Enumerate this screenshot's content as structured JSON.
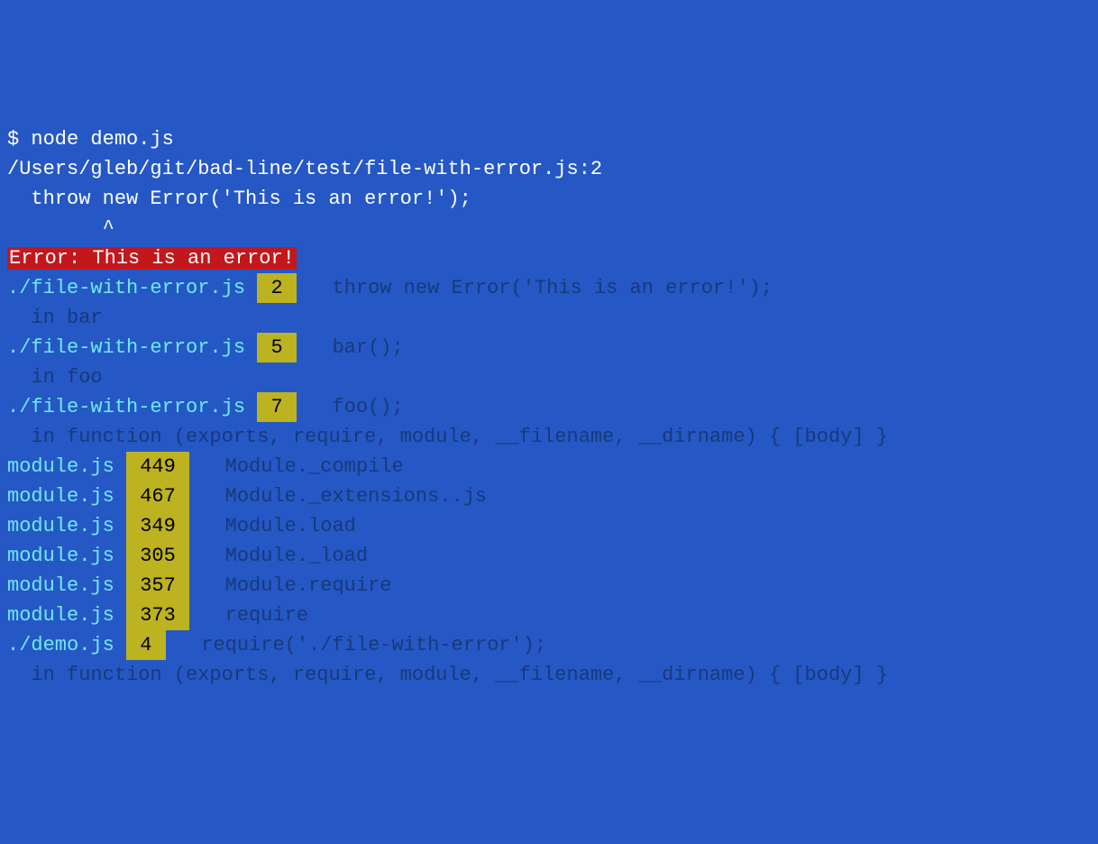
{
  "prompt": {
    "symbol": "$ ",
    "command": "node demo.js"
  },
  "blank1": "",
  "header": {
    "path_line": "/Users/gleb/git/bad-line/test/file-with-error.js:2",
    "code_line": "  throw new Error('This is an error!');",
    "caret_line": "        ^"
  },
  "error_banner": "Error: This is an error!",
  "blank2": "",
  "stack": [
    {
      "kind": "src",
      "file": "./file-with-error.js",
      "line": "2",
      "code": "  throw new Error('This is an error!');"
    },
    {
      "kind": "ctx",
      "text": "  in bar"
    },
    {
      "kind": "src",
      "file": "./file-with-error.js",
      "line": "5",
      "code": "  bar();"
    },
    {
      "kind": "ctx",
      "text": "  in foo"
    },
    {
      "kind": "src",
      "file": "./file-with-error.js",
      "line": "7",
      "code": "  foo();"
    },
    {
      "kind": "ctx",
      "text": "  in function (exports, require, module, __filename, __dirname) { [body] }"
    },
    {
      "kind": "mod",
      "file": "module.js",
      "line": "449",
      "code": "  Module._compile"
    },
    {
      "kind": "mod",
      "file": "module.js",
      "line": "467",
      "code": "  Module._extensions..js"
    },
    {
      "kind": "mod",
      "file": "module.js",
      "line": "349",
      "code": "  Module.load"
    },
    {
      "kind": "mod",
      "file": "module.js",
      "line": "305",
      "code": "  Module._load"
    },
    {
      "kind": "mod",
      "file": "module.js",
      "line": "357",
      "code": "  Module.require"
    },
    {
      "kind": "mod",
      "file": "module.js",
      "line": "373",
      "code": "  require"
    },
    {
      "kind": "src",
      "file": "./demo.js",
      "line": "4",
      "code": "  require('./file-with-error');"
    },
    {
      "kind": "ctx",
      "text": "  in function (exports, require, module, __filename, __dirname) { [body] }"
    }
  ]
}
